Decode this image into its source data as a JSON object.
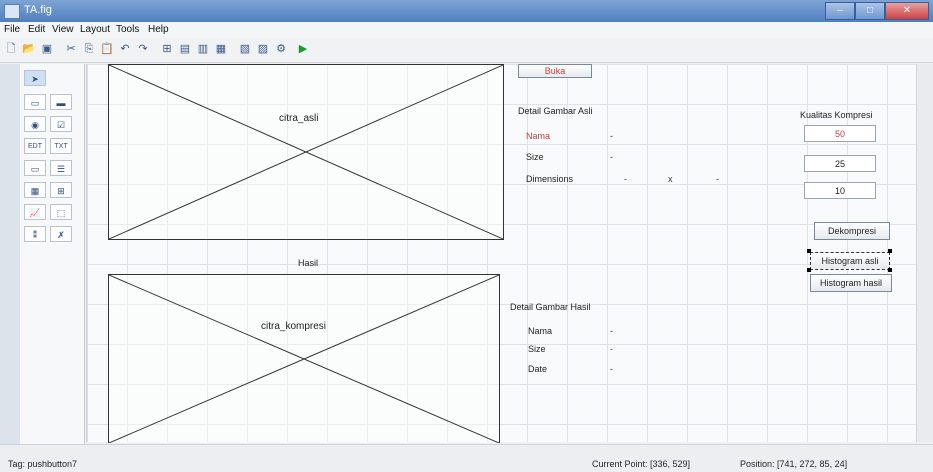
{
  "window": {
    "title": "TA.fig"
  },
  "menu": [
    "File",
    "Edit",
    "View",
    "Layout",
    "Tools",
    "Help"
  ],
  "toolbar_icons": [
    "new-icon",
    "open-icon",
    "save-icon",
    "cut-icon",
    "copy-icon",
    "paste-icon",
    "undo-icon",
    "redo-icon",
    "align-icon",
    "menu-editor-icon",
    "tab-order-icon",
    "toolbar-editor-icon",
    "mfile-icon",
    "property-inspector-icon",
    "object-browser-icon",
    "run-icon"
  ],
  "palette": [
    "select-tool",
    "pushbutton-tool",
    "slider-tool",
    "radio-tool",
    "checkbox-tool",
    "edit-text-tool",
    "static-text-tool",
    "popup-tool",
    "listbox-tool",
    "toggle-tool",
    "table-tool",
    "axes-tool",
    "panel-tool",
    "buttongroup-tool",
    "activex-tool"
  ],
  "palette_labels": {
    "edit": "EDT",
    "text": "TXT"
  },
  "axes1": {
    "label": "citra_asli"
  },
  "axes2": {
    "label": "citra_kompresi",
    "title": "Hasil"
  },
  "top_button": {
    "label": "Buka"
  },
  "detail_asli": {
    "title": "Detail Gambar Asli",
    "nama_label": "Nama",
    "size_label": "Size",
    "dim_label": "Dimensions",
    "dash": "-",
    "x": "x"
  },
  "kualitas": {
    "title": "Kualitas Kompresi",
    "values": [
      "50",
      "25",
      "10"
    ]
  },
  "buttons": {
    "dekompresi": "Dekompresi",
    "hist_asli": "Histogram asli",
    "hist_hasil": "Histogram hasil"
  },
  "detail_hasil": {
    "title": "Detail Gambar Hasil",
    "nama_label": "Nama",
    "size_label": "Size",
    "date_label": "Date",
    "dash": "-"
  },
  "status": {
    "tag": "Tag: pushbutton7",
    "current_point": "Current Point:  [336, 529]",
    "position": "Position:  [741, 272, 85, 24]"
  }
}
